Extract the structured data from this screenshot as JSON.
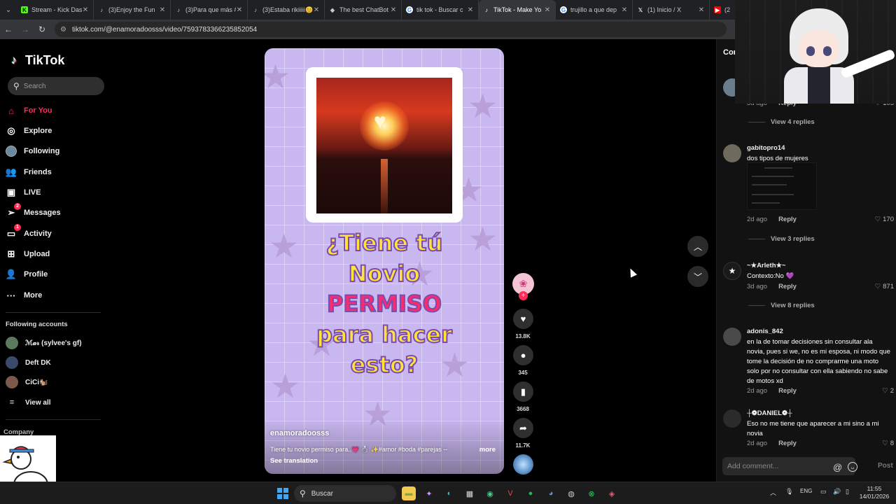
{
  "browser": {
    "tabs": [
      {
        "label": "Stream - Kick Das",
        "icon": "kick-icon",
        "color": "#53fc18",
        "active": false
      },
      {
        "label": "(3)Enjoy the Fun",
        "icon": "tiktok-icon",
        "color": "#ffffff",
        "active": false
      },
      {
        "label": "(3)Para que más #",
        "icon": "tiktok-icon",
        "color": "#ffffff",
        "active": false
      },
      {
        "label": "(3)Estaba rikiiiii😊",
        "icon": "tiktok-icon",
        "color": "#ffffff",
        "active": false
      },
      {
        "label": "The best ChatBot",
        "icon": "chatbot-icon",
        "color": "#ffffff",
        "active": false
      },
      {
        "label": "tik tok - Buscar c",
        "icon": "google-icon",
        "color": "#ffffff",
        "active": false
      },
      {
        "label": "TikTok - Make Yo",
        "icon": "tiktok-icon",
        "color": "#ffffff",
        "active": true
      },
      {
        "label": "trujillo a que dep",
        "icon": "google-icon",
        "color": "#ffffff",
        "active": false
      },
      {
        "label": "(1) Inicio / X",
        "icon": "x-icon",
        "color": "#ffffff",
        "active": false
      },
      {
        "label": "(2",
        "icon": "youtube-icon",
        "color": "#ff0000",
        "active": false
      }
    ],
    "url": "tiktok.com/@enamoradoosss/video/7593783366235852054"
  },
  "sidebar": {
    "brand": "TikTok",
    "search_placeholder": "Search",
    "nav": [
      {
        "label": "For You",
        "icon": "home-icon",
        "active": true,
        "badge": ""
      },
      {
        "label": "Explore",
        "icon": "compass-icon",
        "active": false,
        "badge": ""
      },
      {
        "label": "Following",
        "icon": "following-avatar-icon",
        "active": false,
        "badge": ""
      },
      {
        "label": "Friends",
        "icon": "friends-icon",
        "active": false,
        "badge": ""
      },
      {
        "label": "LIVE",
        "icon": "live-icon",
        "active": false,
        "badge": ""
      },
      {
        "label": "Messages",
        "icon": "send-icon",
        "active": false,
        "badge": "2"
      },
      {
        "label": "Activity",
        "icon": "activity-icon",
        "active": false,
        "badge": "1"
      },
      {
        "label": "Upload",
        "icon": "upload-icon",
        "active": false,
        "badge": ""
      },
      {
        "label": "Profile",
        "icon": "profile-icon",
        "active": false,
        "badge": ""
      },
      {
        "label": "More",
        "icon": "more-icon",
        "active": false,
        "badge": ""
      }
    ],
    "following_header": "Following accounts",
    "following": [
      {
        "name": "ℳ𝒶𝓇 (sylvee's gf)",
        "color": "#5b7a5b"
      },
      {
        "name": "Deft DK",
        "color": "#3b4a6b"
      },
      {
        "name": "CiCi🐿️",
        "color": "#7a5a4a"
      }
    ],
    "view_all": "View all",
    "company": "Company"
  },
  "video": {
    "caption_lines": [
      {
        "text": "¿Tiene tú",
        "color": "yellow"
      },
      {
        "text": "Novio",
        "color": "yellow"
      },
      {
        "text": "PERMISO",
        "color": "pink"
      },
      {
        "text": "para hacer",
        "color": "yellow"
      },
      {
        "text": "esto?",
        "color": "yellow"
      }
    ],
    "author": "enamoradoosss",
    "description": "Tiene tu novio permiso para..💗 💍 ✨#amor #boda #parejas --",
    "more": "more",
    "see_translation": "See translation"
  },
  "actions": {
    "likes": "13.8K",
    "comments": "345",
    "saves": "3668",
    "shares": "11.7K"
  },
  "comments": {
    "header": "Com",
    "top_partial": {
      "date": "3d ago",
      "reply": "Reply",
      "likes": "105"
    },
    "items": [
      {
        "replies_label": "View 4 replies"
      },
      {
        "user": "gabitopro14",
        "text": "dos tipos de mujeres",
        "date": "2d ago",
        "reply": "Reply",
        "likes": "170",
        "replies_label": "View 3 replies"
      },
      {
        "user": "~★Arleth★~",
        "text": "Contexto:No 💜",
        "date": "3d ago",
        "reply": "Reply",
        "likes": "871",
        "replies_label": "View 8 replies"
      },
      {
        "user": "adonis_842",
        "text": "en la de tomar decisiones sin consultar ala novia, pues si we, no es mi esposa, ni modo que tome la decisión de no comprarme una moto solo por no consultar con ella sabiendo no sabe de motos xd",
        "date": "2d ago",
        "reply": "Reply",
        "likes": "2"
      },
      {
        "user": "┼❁DANIEL❁┼",
        "text": "Eso no me tiene que aparecer a mi sino a mi novia",
        "date": "2d ago",
        "reply": "Reply",
        "likes": "8"
      }
    ],
    "add_placeholder": "Add comment...",
    "post": "Post"
  },
  "taskbar": {
    "search": "Buscar",
    "lang": "ENG",
    "time": "11:55",
    "date": "14/01/2026"
  }
}
